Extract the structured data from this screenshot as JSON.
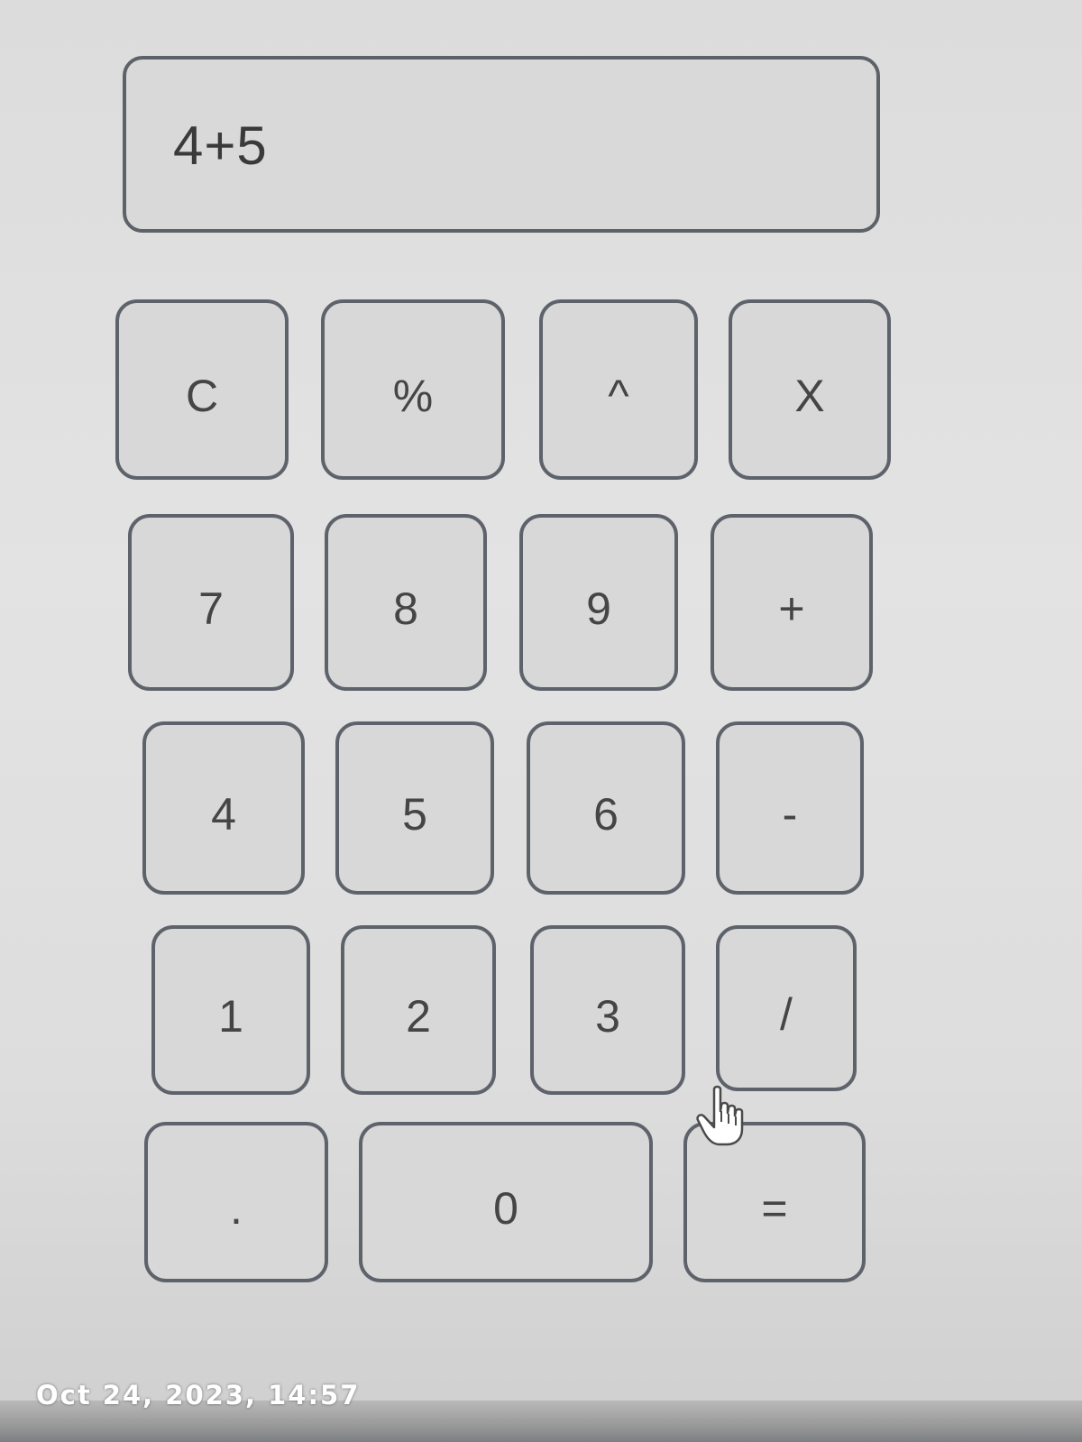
{
  "display": {
    "expression": "4+5"
  },
  "keypad": {
    "clear_label": "C",
    "percent_label": "%",
    "power_label": "^",
    "multiply_label": "X",
    "seven_label": "7",
    "eight_label": "8",
    "nine_label": "9",
    "plus_label": "+",
    "four_label": "4",
    "five_label": "5",
    "six_label": "6",
    "minus_label": "-",
    "one_label": "1",
    "two_label": "2",
    "three_label": "3",
    "divide_label": "/",
    "decimal_label": ".",
    "zero_label": "0",
    "equals_label": "="
  },
  "photo": {
    "timestamp": "Oct 24, 2023, 14:57"
  },
  "icons": {
    "pointer": "hand-pointer-icon"
  }
}
